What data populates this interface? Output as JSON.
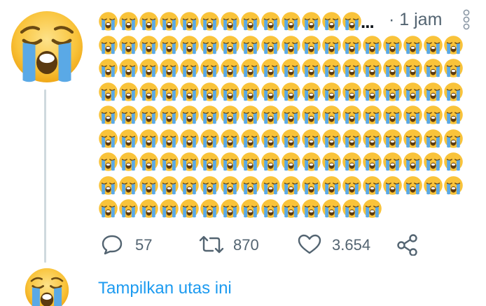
{
  "tweet": {
    "emoji_name": "loudly-crying-face-emoji",
    "emoji_rows": [
      13,
      18,
      18,
      18,
      18,
      18,
      18,
      18,
      14
    ],
    "truncation": "...",
    "time_label": "· 1 jam"
  },
  "actions": {
    "reply_count": "57",
    "retweet_count": "870",
    "like_count": "3.654"
  },
  "thread": {
    "show_thread_label": "Tampilkan utas ini"
  },
  "colors": {
    "link": "#1d9bf0",
    "muted": "#536471",
    "thread_line": "#cfd9de",
    "emoji_face": "#f9c33a",
    "emoji_tear": "#5aa9e6"
  }
}
